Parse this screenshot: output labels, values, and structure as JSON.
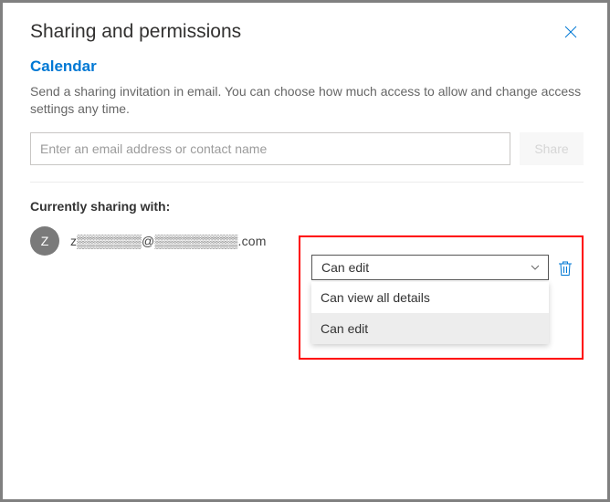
{
  "header": {
    "title": "Sharing and permissions"
  },
  "calendar": {
    "name": "Calendar",
    "description": "Send a sharing invitation in email. You can choose how much access to allow and change access settings any time."
  },
  "invite": {
    "placeholder": "Enter an email address or contact name",
    "share_label": "Share"
  },
  "sharing": {
    "heading": "Currently sharing with:",
    "entries": [
      {
        "avatar_initial": "Z",
        "display": "z▒▒▒▒▒▒▒@▒▒▒▒▒▒▒▒▒.com",
        "permission_selected": "Can edit",
        "permission_options": [
          "Can view all details",
          "Can edit"
        ]
      }
    ]
  }
}
